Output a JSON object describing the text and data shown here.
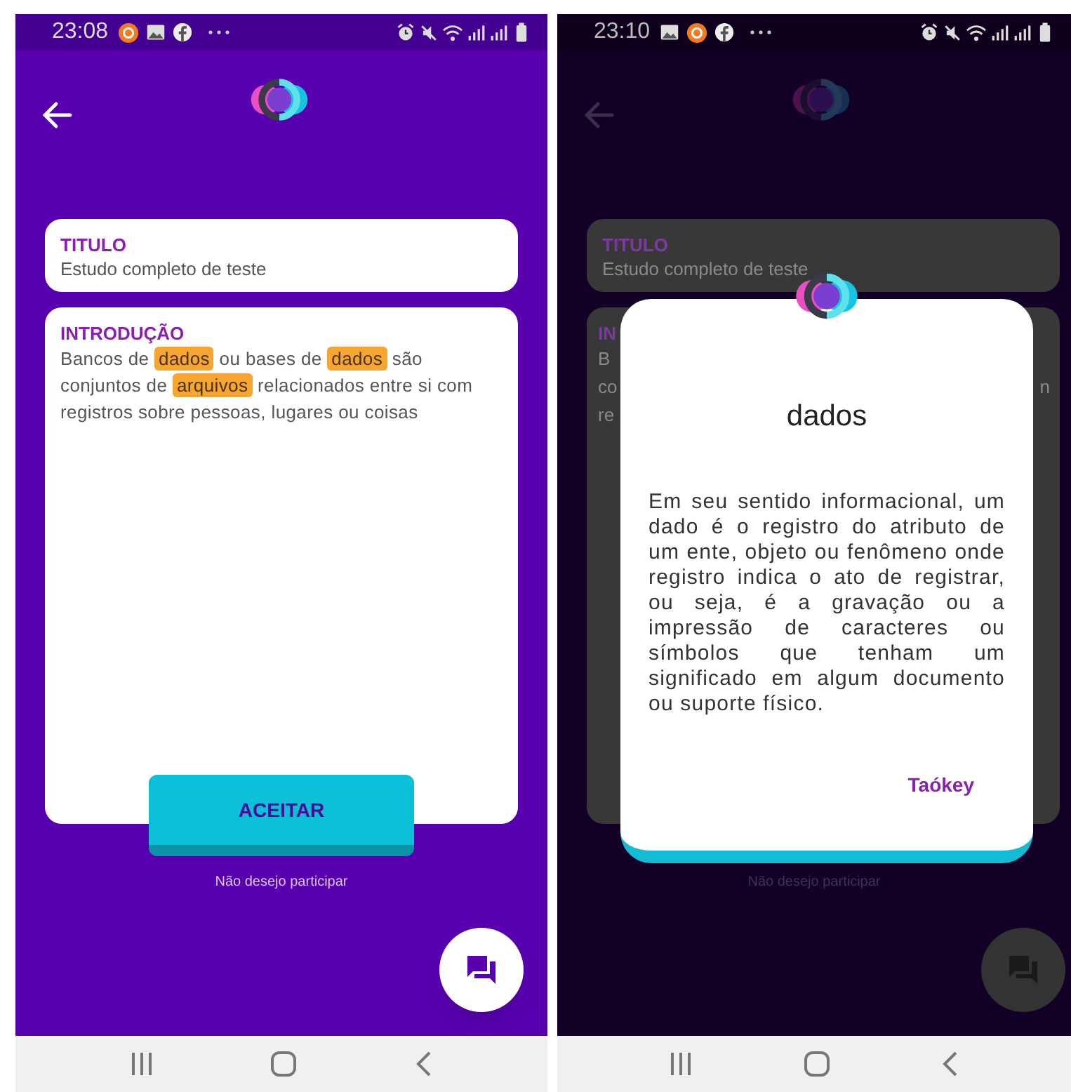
{
  "screens": [
    {
      "dimmed": false,
      "status_bar": {
        "time": "23:08",
        "notification_icons": [
          {
            "kind": "recorder"
          },
          {
            "kind": "image"
          },
          {
            "kind": "facebook"
          },
          {
            "kind": "more"
          }
        ]
      },
      "title_card": {
        "label": "TITULO",
        "value": "Estudo completo de teste"
      },
      "intro_card": {
        "label": "INTRODUÇÃO",
        "segments": [
          {
            "text": "Bancos de ",
            "highlighted": false
          },
          {
            "text": "dados",
            "highlighted": true
          },
          {
            "text": " ou bases de ",
            "highlighted": false
          },
          {
            "text": "dados",
            "highlighted": true
          },
          {
            "text": " são conjuntos de ",
            "highlighted": false
          },
          {
            "text": "arquivos",
            "highlighted": true
          },
          {
            "text": " relacionados entre si com registros sobre pessoas, lugares ou coisas",
            "highlighted": false
          }
        ]
      },
      "accept_button": "ACEITAR",
      "decline_link": "Não desejo participar"
    },
    {
      "dimmed": true,
      "status_bar": {
        "time": "23:10",
        "notification_icons": [
          {
            "kind": "image"
          },
          {
            "kind": "recorder"
          },
          {
            "kind": "facebook"
          },
          {
            "kind": "more"
          }
        ]
      },
      "title_card": {
        "label": "TITULO",
        "value": "Estudo completo de teste"
      },
      "intro_card": {
        "label": "IN",
        "line_starts": [
          "B",
          "co",
          "re"
        ],
        "line_end": "n"
      },
      "decline_link": "Não desejo participar",
      "dialog": {
        "title": "dados",
        "body": "Em seu sentido informacional, um dado é o registro do atributo de um ente, objeto ou fenômeno onde registro indica o ato de registrar, ou seja, é a gravação ou a impressão de caracteres ou símbolos que tenham um significado em algum documento ou suporte físico.",
        "button": "Taókey"
      }
    }
  ]
}
